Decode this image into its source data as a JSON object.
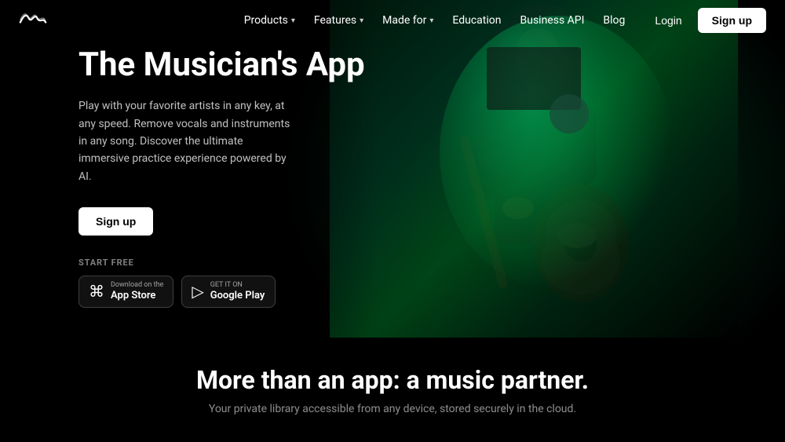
{
  "nav": {
    "logo_alt": "Moises logo",
    "links": [
      {
        "label": "Products",
        "has_dropdown": true
      },
      {
        "label": "Features",
        "has_dropdown": true
      },
      {
        "label": "Made for",
        "has_dropdown": true
      },
      {
        "label": "Education",
        "has_dropdown": false
      },
      {
        "label": "Business API",
        "has_dropdown": false
      },
      {
        "label": "Blog",
        "has_dropdown": false
      }
    ],
    "login_label": "Login",
    "signup_label": "Sign up"
  },
  "hero": {
    "title": "The Musician's App",
    "description": "Play with your favorite artists in any key, at any speed. Remove vocals and instruments in any song. Discover the ultimate immersive practice experience powered by AI.",
    "signup_label": "Sign up",
    "start_free_label": "START FREE",
    "app_store": {
      "sub": "Download on the",
      "name": "App Store"
    },
    "google_play": {
      "sub": "GET IT ON",
      "name": "Google Play"
    }
  },
  "bottom": {
    "title": "More than an app: a music partner.",
    "subtitle": "Your private library accessible from any device, stored securely in the cloud."
  }
}
